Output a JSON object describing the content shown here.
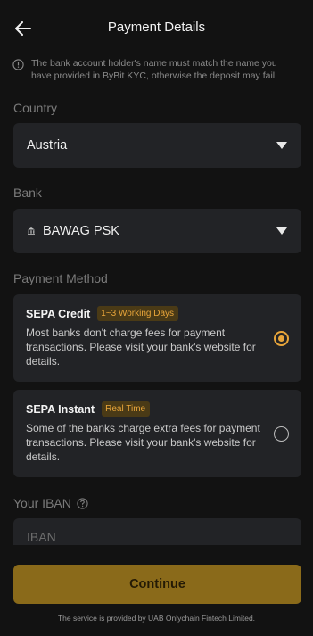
{
  "header": {
    "title": "Payment Details"
  },
  "notice": "The bank account holder's name must match the name you have provided in ByBit KYC, otherwise the deposit may fail.",
  "country": {
    "label": "Country",
    "value": "Austria"
  },
  "bank": {
    "label": "Bank",
    "value": "BAWAG PSK"
  },
  "payment_method": {
    "label": "Payment Method",
    "options": [
      {
        "name": "SEPA Credit",
        "badge": "1~3 Working Days",
        "description": "Most banks don't charge fees for payment transactions. Please visit your bank's website for details.",
        "selected": true
      },
      {
        "name": "SEPA Instant",
        "badge": "Real Time",
        "description": "Some of the banks charge extra fees for payment transactions. Please visit your bank's website for details.",
        "selected": false
      }
    ]
  },
  "iban": {
    "label": "Your IBAN",
    "placeholder": "IBAN",
    "value": ""
  },
  "continue_label": "Continue",
  "footer": "The service is provided by UAB Onlychain Fintech Limited.",
  "colors": {
    "accent": "#e8a53a",
    "background": "#121212",
    "surface": "#222326",
    "button": "#8a6a1a"
  }
}
